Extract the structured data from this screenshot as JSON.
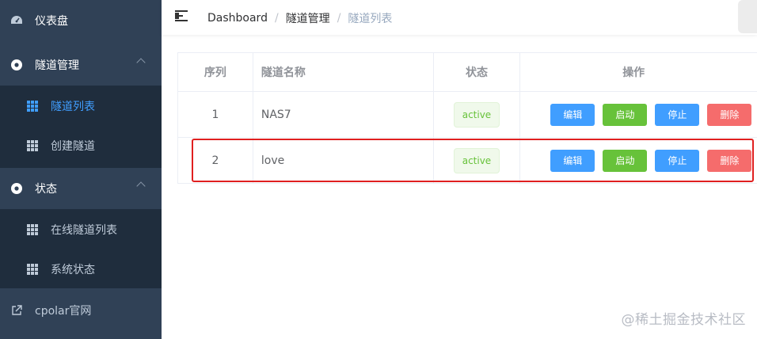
{
  "sidebar": {
    "dashboard": "仪表盘",
    "tunnel_mgmt": "隧道管理",
    "tunnel_list": "隧道列表",
    "create_tunnel": "创建隧道",
    "status": "状态",
    "online_tunnels": "在线隧道列表",
    "system_status": "系统状态",
    "cpolar_site": "cpolar官网"
  },
  "breadcrumb": {
    "home": "Dashboard",
    "sep": "/",
    "section": "隧道管理",
    "current": "隧道列表"
  },
  "table": {
    "headers": [
      "序列",
      "隧道名称",
      "状态",
      "操作"
    ],
    "rows": [
      {
        "index": "1",
        "name": "NAS7",
        "status": "active"
      },
      {
        "index": "2",
        "name": "love",
        "status": "active"
      }
    ],
    "actions": {
      "edit": "编辑",
      "start": "启动",
      "stop": "停止",
      "delete": "删除"
    }
  },
  "watermark": "@稀土掘金技术社区",
  "colors": {
    "sidebar_bg": "#304156",
    "submenu_bg": "#1f2d3d",
    "active_link": "#409eff",
    "highlight": "#e02020"
  }
}
